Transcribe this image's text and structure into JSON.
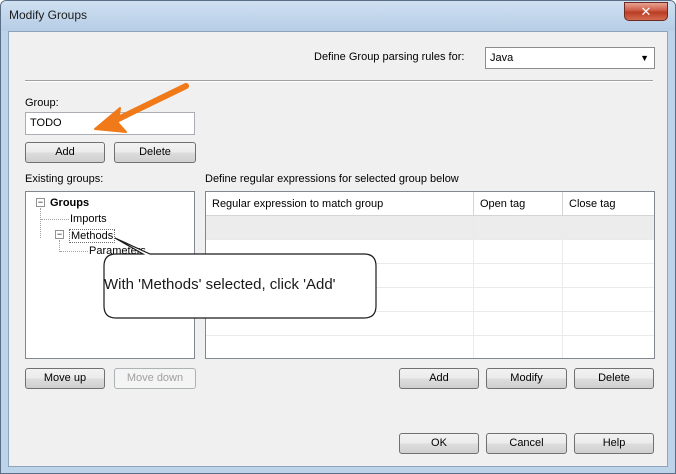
{
  "window": {
    "title": "Modify Groups",
    "close_glyph": "✕"
  },
  "parsing": {
    "label": "Define Group parsing rules for:",
    "selected": "Java",
    "dropdown_glyph": "▼"
  },
  "group": {
    "label": "Group:",
    "value": "TODO",
    "add_label": "Add",
    "delete_label": "Delete"
  },
  "existing": {
    "label": "Existing groups:",
    "tree": [
      {
        "label": "Groups",
        "bold": true,
        "expander": "−"
      },
      {
        "label": "Imports"
      },
      {
        "label": "Methods",
        "expander": "−"
      },
      {
        "label": "Parameters"
      }
    ],
    "move_up_label": "Move up",
    "move_down_label": "Move down"
  },
  "regex": {
    "label": "Define regular expressions for selected group below",
    "columns": [
      "Regular expression to match group",
      "Open tag",
      "Close tag"
    ],
    "add_label": "Add",
    "modify_label": "Modify",
    "delete_label": "Delete"
  },
  "footer": {
    "ok_label": "OK",
    "cancel_label": "Cancel",
    "help_label": "Help"
  },
  "callout": {
    "text": "With 'Methods' selected, click 'Add'"
  },
  "colors": {
    "annotation_arrow": "#f07a1a",
    "window_frame": "#bcd3ea",
    "dialog_bg": "#f0f0f0"
  }
}
